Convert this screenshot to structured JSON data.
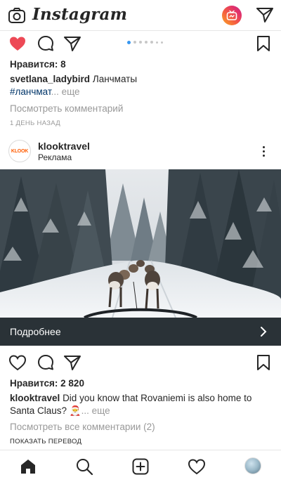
{
  "top_bar": {
    "logo": "Instagram",
    "icons": [
      "camera-icon",
      "igtv-icon",
      "direct-message-icon"
    ]
  },
  "post1": {
    "likes": "Нравится: 8",
    "caption_user": "svetlana_ladybird",
    "caption_text": "Ланчматы",
    "hashtag": "#ланчмат",
    "more": "... еще",
    "view_comments": "Посмотреть комментарий",
    "time": "1 ДЕНЬ НАЗАД",
    "carousel": {
      "count": 7,
      "active_index": 0
    }
  },
  "post2": {
    "username": "klooktravel",
    "sponsored": "Реклама",
    "avatar_text": "KLOOK",
    "cta": "Подробнее",
    "likes": "Нравится: 2 820",
    "caption_user": "klooktravel",
    "caption_text_1": "Did you know that Rovaniemi is also home to",
    "caption_text_2": "Santa Claus? 🎅",
    "more": "... еще",
    "view_comments": "Посмотреть все комментарии (2)",
    "translate": "ПОКАЗАТЬ ПЕРЕВОД"
  },
  "bottom_nav": [
    "home-icon",
    "search-icon",
    "new-post-icon",
    "activity-icon",
    "profile-avatar"
  ],
  "colors": {
    "like_red": "#ed4956",
    "link_blue": "#003569",
    "cta_bar": "#2a3237",
    "carousel_active": "#3897f0"
  }
}
